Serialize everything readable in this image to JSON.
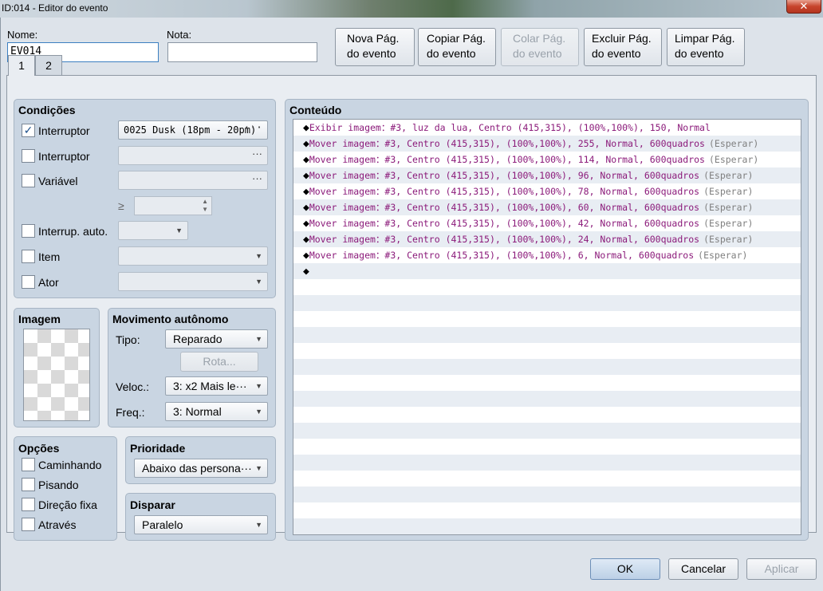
{
  "window": {
    "title": "ID:014 - Editor do evento",
    "close": "✕"
  },
  "top": {
    "name_label": "Nome:",
    "name_value": "EV014",
    "note_label": "Nota:",
    "note_value": ""
  },
  "page_buttons": [
    {
      "l1": "Nova Pág.",
      "l2": "do evento"
    },
    {
      "l1": "Copiar Pág.",
      "l2": "do evento"
    },
    {
      "l1": "Colar Pág.",
      "l2": "do evento"
    },
    {
      "l1": "Excluir Pág.",
      "l2": "do evento"
    },
    {
      "l1": "Limpar Pág.",
      "l2": "do evento"
    }
  ],
  "tabs": [
    "1",
    "2"
  ],
  "conditions": {
    "title": "Condições",
    "switch1_label": "Interruptor",
    "switch1_value": "0025 Dusk (18pm - 20pm)",
    "switch1_checked": "✓",
    "switch2_label": "Interruptor",
    "variable_label": "Variável",
    "ge": "≥",
    "selfswitch_label": "Interrup. auto.",
    "item_label": "Item",
    "actor_label": "Ator",
    "ellipsis": "···"
  },
  "image": {
    "title": "Imagem"
  },
  "movement": {
    "title": "Movimento autônomo",
    "type_label": "Tipo:",
    "type_value": "Reparado",
    "route_button": "Rota...",
    "speed_label": "Veloc.:",
    "speed_value": "3: x2 Mais le···",
    "freq_label": "Freq.:",
    "freq_value": "3: Normal"
  },
  "options": {
    "title": "Opções",
    "walking": "Caminhando",
    "stepping": "Pisando",
    "direction_fix": "Direção fixa",
    "through": "Através"
  },
  "priority": {
    "title": "Prioridade",
    "value": "Abaixo das persona···"
  },
  "trigger": {
    "title": "Disparar",
    "value": "Paralelo"
  },
  "contents": {
    "title": "Conteúdo",
    "rows": [
      {
        "text": "Exibir imagem：#3, luz da lua, Centro (415,315), (100%,100%), 150, Normal",
        "wait": ""
      },
      {
        "text": "Mover imagem：#3, Centro (415,315), (100%,100%), 255, Normal, 600quadros",
        "wait": "(Esperar)"
      },
      {
        "text": "Mover imagem：#3, Centro (415,315), (100%,100%), 114, Normal, 600quadros",
        "wait": "(Esperar)"
      },
      {
        "text": "Mover imagem：#3, Centro (415,315), (100%,100%), 96, Normal, 600quadros",
        "wait": "(Esperar)"
      },
      {
        "text": "Mover imagem：#3, Centro (415,315), (100%,100%), 78, Normal, 600quadros",
        "wait": "(Esperar)"
      },
      {
        "text": "Mover imagem：#3, Centro (415,315), (100%,100%), 60, Normal, 600quadros",
        "wait": "(Esperar)"
      },
      {
        "text": "Mover imagem：#3, Centro (415,315), (100%,100%), 42, Normal, 600quadros",
        "wait": "(Esperar)"
      },
      {
        "text": "Mover imagem：#3, Centro (415,315), (100%,100%), 24, Normal, 600quadros",
        "wait": "(Esperar)"
      },
      {
        "text": "Mover imagem：#3, Centro (415,315), (100%,100%), 6, Normal, 600quadros",
        "wait": "(Esperar)"
      },
      {
        "text": "",
        "wait": ""
      }
    ],
    "bullet": "◆"
  },
  "footer": {
    "ok": "OK",
    "cancel": "Cancelar",
    "apply": "Aplicar"
  }
}
